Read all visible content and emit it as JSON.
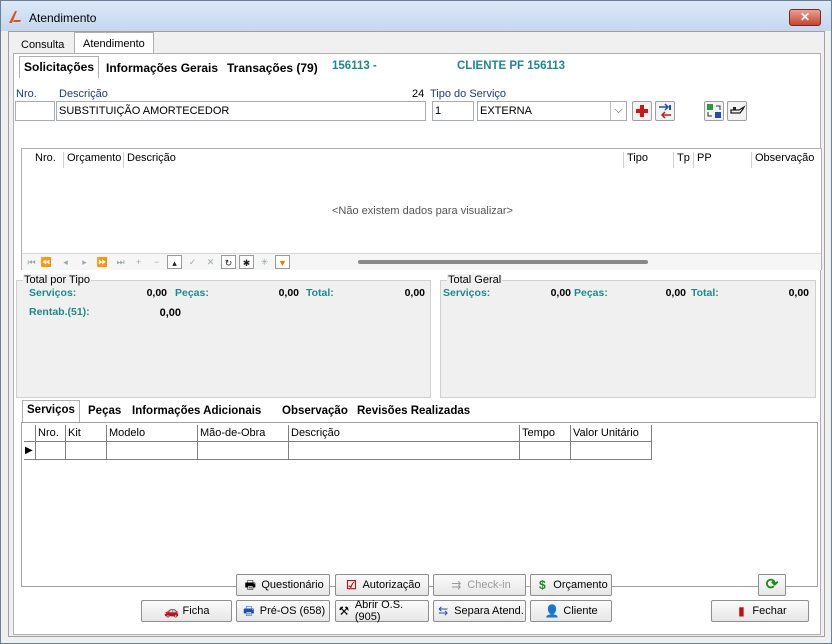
{
  "window": {
    "title": "Atendimento",
    "close_label": "✕"
  },
  "outer_tabs": [
    "Consulta",
    "Atendimento"
  ],
  "inner_tabs": [
    "Solicitações",
    "Informações Gerais",
    "Transações (79)"
  ],
  "header_info": {
    "code": "156113 -",
    "client": "CLIENTE PF 156113"
  },
  "form": {
    "nro_label": "Nro.",
    "nro_value": "",
    "descricao_label": "Descrição",
    "descricao_value": "SUBSTITUIÇÃO AMORTECEDOR",
    "counter": "24",
    "tipo_servico_label": "Tipo do Serviço",
    "tipo_code": "1",
    "tipo_value": "EXTERNA"
  },
  "grid1": {
    "columns": [
      "Nro.",
      "Orçamento",
      "Descrição",
      "Tipo",
      "Tp",
      "PP",
      "Observação"
    ],
    "empty_text": "<Não existem dados para visualizar>"
  },
  "totals_por_tipo": {
    "caption": "Total por Tipo",
    "servicos_label": "Serviços:",
    "servicos_value": "0,00",
    "pecas_label": "Peças:",
    "pecas_value": "0,00",
    "total_label": "Total:",
    "total_value": "0,00",
    "rentab_label": "Rentab.(51):",
    "rentab_value": "0,00"
  },
  "totals_geral": {
    "caption": "Total Geral",
    "servicos_label": "Serviços:",
    "servicos_value": "0,00",
    "pecas_label": "Peças:",
    "pecas_value": "0,00",
    "total_label": "Total:",
    "total_value": "0,00"
  },
  "bottom_tabs": [
    "Serviços",
    "Peças",
    "Informações Adicionais",
    "Observação",
    "Revisões Realizadas"
  ],
  "grid2": {
    "columns": [
      "Nro.",
      "Kit",
      "Modelo",
      "Mão-de-Obra",
      "Descrição",
      "Tempo",
      "Valor Unitário"
    ]
  },
  "buttons": {
    "questionario": "Questionário",
    "autorizacao": "Autorização",
    "checkin": "Check-in",
    "orcamento": "Orçamento",
    "ficha": "Ficha",
    "preos": "Pré-OS (658)",
    "abrir_os": "Abrir O.S.(905)",
    "separa": "Separa Atend.",
    "cliente": "Cliente",
    "fechar": "Fechar"
  }
}
